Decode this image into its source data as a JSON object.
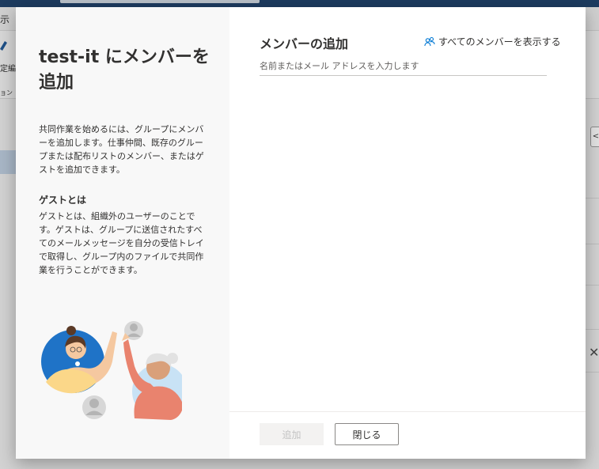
{
  "background": {
    "menu_label": "示",
    "ribbon_label": "定編集",
    "ribbon_sublabel": "ョン",
    "right_button": "<",
    "right_close": "✕"
  },
  "dialog": {
    "title": "test-it にメンバーを追加",
    "intro": "共同作業を始めるには、グループにメンバーを追加します。仕事仲間、既存のグループまたは配布リストのメンバー、またはゲストを追加できます。",
    "guest_heading": "ゲストとは",
    "guest_text": "ゲストとは、組織外のユーザーのことです。ゲストは、グループに送信されたすべてのメールメッセージを自分の受信トレイで取得し、グループ内のファイルで共同作業を行うことができます。",
    "add_heading": "メンバーの追加",
    "show_all_label": "すべてのメンバーを表示する",
    "search": {
      "placeholder": "名前またはメール アドレスを入力します",
      "value": ""
    },
    "add_button": "追加",
    "close_button": "閉じる",
    "colors": {
      "accent": "#0078d4",
      "disabled_text": "#c3c3c3",
      "left_pane": "#f8f8f8"
    }
  }
}
